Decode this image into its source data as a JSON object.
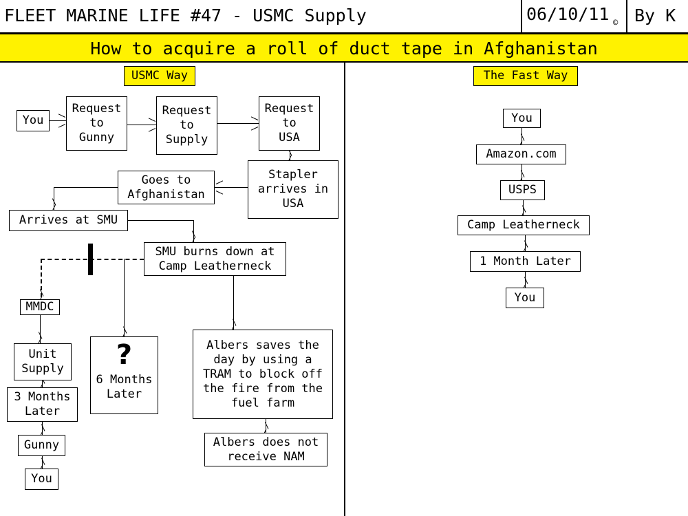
{
  "header": {
    "comic_title": "FLEET MARINE LIFE #47 - USMC Supply",
    "date": "06/10/11",
    "copyright_symbol": "©",
    "author": "By K"
  },
  "banner": {
    "text": "How to acquire a roll of duct tape in Afghanistan",
    "background_color": "#FFF200"
  },
  "columns": {
    "left": {
      "label": "USMC Way",
      "nodes": {
        "you_start": "You",
        "request_gunny": "Request\nto\nGunny",
        "request_supply": "Request\nto\nSupply",
        "request_usa": "Request\nto\nUSA",
        "stapler_usa": "Stapler\narrives in\nUSA",
        "goes_afghanistan": "Goes to\nAfghanistan",
        "arrives_smu": "Arrives at SMU",
        "smu_burns": "SMU burns down at\nCamp Leatherneck",
        "mmdc": "MMDC",
        "unit_supply": "Unit\nSupply",
        "three_months": "3 Months\nLater",
        "gunny": "Gunny",
        "you_end": "You",
        "six_months_icon": "?",
        "six_months": "6 Months\nLater",
        "albers_saves": "Albers saves the\nday by using a\nTRAM to block off\nthe fire from the\nfuel farm",
        "albers_nam": "Albers does not\nreceive NAM"
      }
    },
    "right": {
      "label": "The Fast Way",
      "nodes": {
        "you_start": "You",
        "amazon": "Amazon.com",
        "usps": "USPS",
        "camp_leatherneck": "Camp Leatherneck",
        "one_month": "1 Month Later",
        "you_end": "You"
      }
    }
  }
}
